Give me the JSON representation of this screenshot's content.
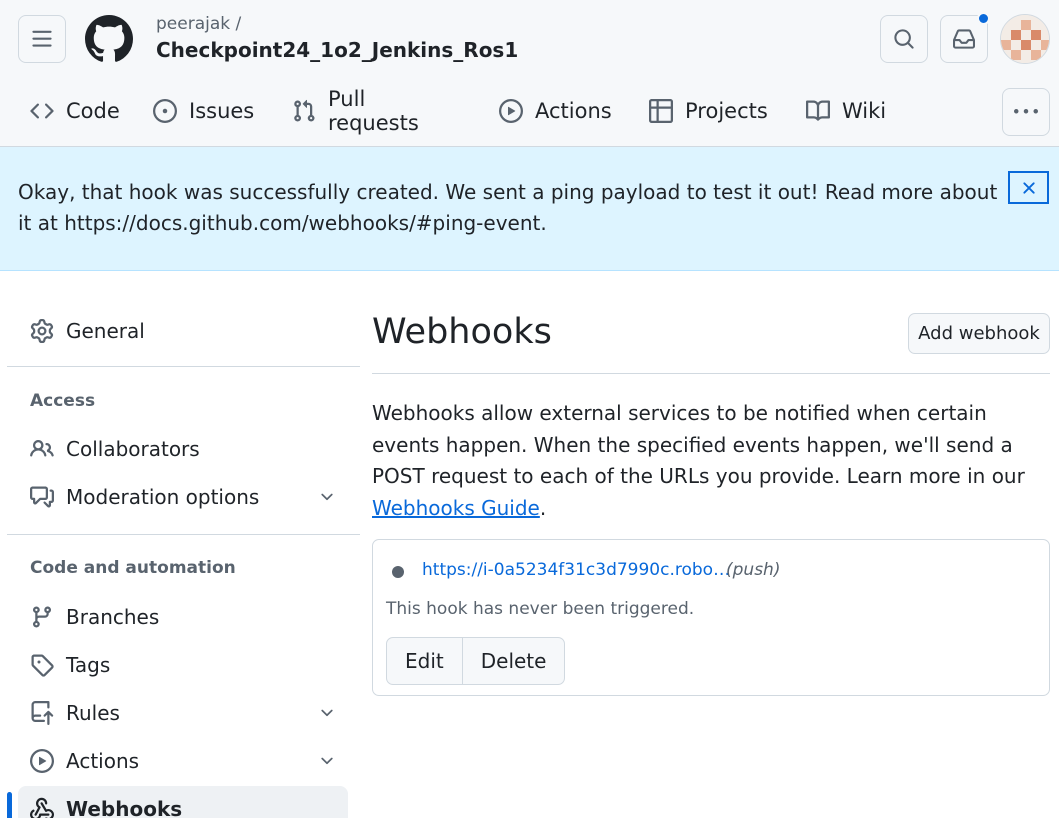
{
  "header": {
    "owner": "peerajak /",
    "repo": "Checkpoint24_1o2_Jenkins_Ros1"
  },
  "tabs": [
    {
      "label": "Code",
      "icon": "code-icon"
    },
    {
      "label": "Issues",
      "icon": "issue-opened-icon"
    },
    {
      "label": "Pull requests",
      "icon": "git-pull-request-icon"
    },
    {
      "label": "Actions",
      "icon": "play-icon"
    },
    {
      "label": "Projects",
      "icon": "table-icon"
    },
    {
      "label": "Wiki",
      "icon": "book-icon"
    }
  ],
  "flash": {
    "message": "Okay, that hook was successfully created. We sent a ping payload to test it out! Read more about it at https://docs.github.com/webhooks/#ping-event."
  },
  "sidebar": {
    "general": "General",
    "access_heading": "Access",
    "collaborators": "Collaborators",
    "moderation": "Moderation options",
    "code_heading": "Code and automation",
    "branches": "Branches",
    "tags": "Tags",
    "rules": "Rules",
    "actions": "Actions",
    "webhooks": "Webhooks"
  },
  "main": {
    "title": "Webhooks",
    "add_button": "Add webhook",
    "description": "Webhooks allow external services to be notified when certain events happen. When the specified events happen, we'll send a POST request to each of the URLs you provide. Learn more in our ",
    "guide_link": "Webhooks Guide",
    "period": "."
  },
  "hook": {
    "url": "https://i-0a5234f31c3d7990c.robo…",
    "event": "(push)",
    "status": "This hook has never been triggered.",
    "edit": "Edit",
    "delete": "Delete"
  },
  "colors": {
    "accent": "#0969da",
    "flash_bg": "#ddf4ff",
    "header_bg": "#f6f8fa"
  }
}
